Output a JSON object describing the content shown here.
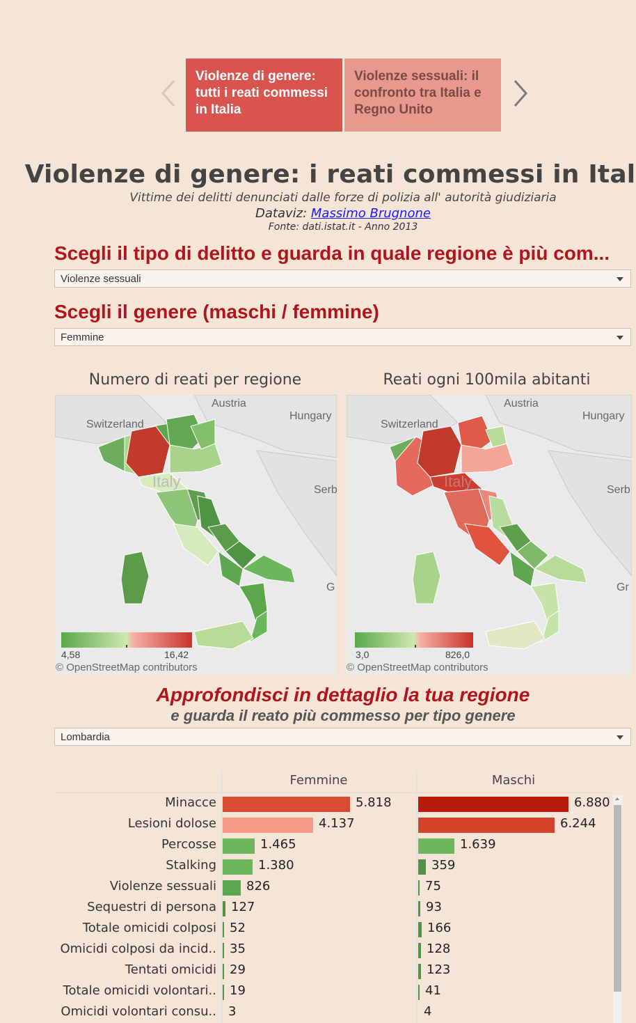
{
  "story": {
    "tabs": [
      {
        "label": "Violenze di genere: tutti i reati commessi in Italia"
      },
      {
        "label": "Violenze sessuali: il confronto tra Italia e Regno Unito"
      }
    ]
  },
  "header": {
    "title": "Violenze di genere: i reati commessi in Italia",
    "subtitle": "Vittime dei delitti denunciati dalle forze di polizia all' autorità giudiziaria",
    "dataviz_prefix": "Dataviz: ",
    "dataviz_author": "Massimo Brugnone",
    "source": "Fonte: dati.istat.it - Anno 2013"
  },
  "filters": {
    "crime_heading": "Scegli il tipo di delitto e guarda in quale regione è più com...",
    "crime_value": "Violenze sessuali",
    "gender_heading": "Scegli il genere (maschi / femmine)",
    "gender_value": "Femmine"
  },
  "maps": [
    {
      "title": "Numero di reati per regione",
      "legend_min": "4,58",
      "legend_max": "16,42",
      "labels": {
        "austria": "Austria",
        "switzerland": "Switzerland",
        "hungary": "Hungary",
        "serbia": "Serb",
        "italy": "Italy",
        "greece": "G"
      },
      "credit": "© OpenStreetMap contributors",
      "legend_colors": [
        "#5aa84a",
        "#cfe8b0",
        "#f5b0a4",
        "#c9312a"
      ]
    },
    {
      "title": "Reati ogni 100mila abitanti",
      "legend_min": "3,0",
      "legend_max": "826,0",
      "labels": {
        "austria": "Austria",
        "switzerland": "Switzerland",
        "hungary": "Hungary",
        "serbia": "Serb",
        "italy": "Italy",
        "greece": "Gr"
      },
      "credit": "© OpenStreetMap contributors",
      "legend_colors": [
        "#5aa84a",
        "#cfe8b0",
        "#f5b0a4",
        "#c9312a"
      ]
    }
  ],
  "detail": {
    "title": "Approfondisci in dettaglio la tua regione",
    "subtitle": "e guarda il reato più commesso per tipo genere",
    "region_value": "Lombardia"
  },
  "chart_data": {
    "type": "bar",
    "title": "",
    "categories": [
      "Minacce",
      "Lesioni dolose",
      "Percosse",
      "Stalking",
      "Violenze sessuali",
      "Sequestri di persona",
      "Totale omicidi colposi",
      "Omicidi colposi da incid..",
      "Tentati omicidi",
      "Totale omicidi volontari..",
      "Omicidi volontari consu.."
    ],
    "series": [
      {
        "name": "Femmine",
        "values": [
          5818,
          4137,
          1465,
          1380,
          826,
          127,
          52,
          35,
          29,
          19,
          3
        ],
        "labels": [
          "5.818",
          "4.137",
          "1.465",
          "1.380",
          "826",
          "127",
          "52",
          "35",
          "29",
          "19",
          "3"
        ],
        "colors": [
          "#d94c32",
          "#f59a86",
          "#6ab85b",
          "#6ab85b",
          "#5ea650",
          "#4f9442",
          "#4f9442",
          "#4f9442",
          "#4f9442",
          "#4f9442",
          "#4f9442"
        ]
      },
      {
        "name": "Maschi",
        "values": [
          6880,
          6244,
          1639,
          359,
          75,
          93,
          166,
          128,
          123,
          41,
          4
        ],
        "labels": [
          "6.880",
          "6.244",
          "1.639",
          "359",
          "75",
          "93",
          "166",
          "128",
          "123",
          "41",
          "4"
        ],
        "colors": [
          "#b81a0c",
          "#d2432a",
          "#6ab85b",
          "#4f9442",
          "#4f9442",
          "#4f9442",
          "#4f9442",
          "#4f9442",
          "#4f9442",
          "#4f9442",
          "#4f9442"
        ]
      }
    ],
    "xmax": 7000
  }
}
